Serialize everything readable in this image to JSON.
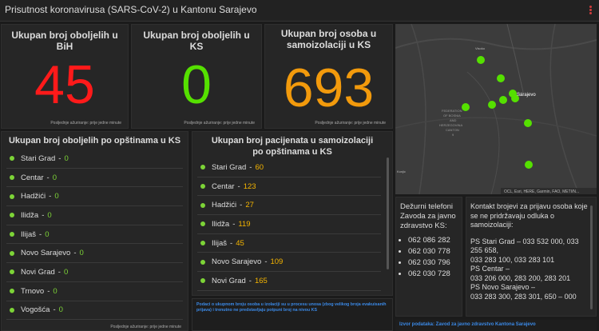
{
  "header": {
    "title": "Prisutnost koronavirusa (SARS-CoV-2) u Kantonu Sarajevo"
  },
  "updated_label": "Posljednje ažuriranje: prije jedne minute",
  "colors": {
    "red": "#ff1a1a",
    "green": "#55e000",
    "orange": "#f29a0c",
    "accent": "#3b8ae8"
  },
  "cards": {
    "bih": {
      "title": "Ukupan broj oboljelih u BiH",
      "value": "45"
    },
    "ks": {
      "title": "Ukupan broj oboljelih u KS",
      "value": "0"
    },
    "isolation": {
      "title": "Ukupan broj osoba u samoizolaciji u KS",
      "value": "693"
    }
  },
  "municipalities_sick": {
    "title": "Ukupan broj oboljelih po opštinama u KS",
    "items": [
      {
        "name": "Stari Grad",
        "value": "0"
      },
      {
        "name": "Centar",
        "value": "0"
      },
      {
        "name": "Hadžići",
        "value": "0"
      },
      {
        "name": "Ilidža",
        "value": "0"
      },
      {
        "name": "Ilijaš",
        "value": "0"
      },
      {
        "name": "Novo Sarajevo",
        "value": "0"
      },
      {
        "name": "Novi Grad",
        "value": "0"
      },
      {
        "name": "Trnovo",
        "value": "0"
      },
      {
        "name": "Vogošća",
        "value": "0"
      }
    ]
  },
  "municipalities_isolation": {
    "title": "Ukupan broj pacijenata u samoizolaciji po opštinama u KS",
    "items": [
      {
        "name": "Stari Grad",
        "value": "60"
      },
      {
        "name": "Centar",
        "value": "123"
      },
      {
        "name": "Hadžići",
        "value": "27"
      },
      {
        "name": "Ilidža",
        "value": "119"
      },
      {
        "name": "Ilijaš",
        "value": "45"
      },
      {
        "name": "Novo Sarajevo",
        "value": "109"
      },
      {
        "name": "Novi Grad",
        "value": "165"
      }
    ]
  },
  "map": {
    "labels": {
      "city": "Sarajevo",
      "visoko": "Visoko",
      "fed1": "FEDERATION",
      "fed2": "OF BOSNIA",
      "fed3": "AND",
      "fed4": "HERZEGOVINA",
      "fed5": "CANTON",
      "fed6": "9",
      "konjic": "Konjic"
    },
    "attribution": "OCL, Esri, HERE, Garmin, FAO, METI/N..."
  },
  "phones": {
    "title": "Dežurni telefoni Zavoda za javno zdravstvo KS:",
    "numbers": [
      "062 086 282",
      "062 030 778",
      "062 030 796",
      "062 030 728"
    ]
  },
  "contacts": {
    "title": "Kontakt brojevi za prijavu osoba koje se ne pridržavaju odluka o samoizolaciji:",
    "lines": [
      "PS Stari Grad – 033 532 000, 033 255 658,",
      "033 283 100, 033 283 101",
      "PS Centar –",
      "033 206 000, 283 200, 283 201",
      "PS Novo Sarajevo –",
      "033 283 300, 283 301, 650 – 000"
    ]
  },
  "note": "Podaci o ukupnom broju osoba u izolaciji su u procesu unosa (zbog velikog broja evakuisanih prijava) i trenutno ne predstavljaju potpuni broj na nivou KS",
  "source": "Izvor podataka: Zavod za javno zdravstvo Kantona Sarajevo"
}
